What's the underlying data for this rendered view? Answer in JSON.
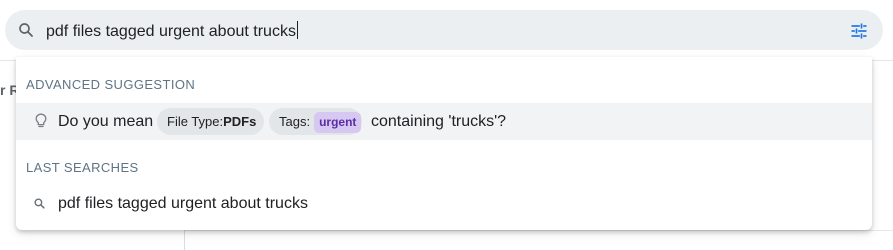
{
  "search": {
    "query": "pdf files tagged urgent about trucks",
    "icon": "search-icon",
    "filter_icon": "tune-icon"
  },
  "background": {
    "nav_label_fragment": "r R"
  },
  "dropdown": {
    "advanced_header": "ADVANCED SUGGESTION",
    "suggestion": {
      "prefix": "Do you mean",
      "file_type_label": "File Type:",
      "file_type_value": "PDFs",
      "tags_label": "Tags:",
      "tag_value": "urgent",
      "suffix": "containing 'trucks'?",
      "icon": "lightbulb-icon"
    },
    "last_header": "LAST SEARCHES",
    "history": [
      {
        "text": "pdf files tagged urgent about trucks",
        "icon": "search-icon"
      }
    ]
  },
  "colors": {
    "search_bar_bg": "#eceff1",
    "accent": "#1a73e8",
    "header_text": "#5f7485",
    "tag_pill_bg": "#d7c8f2",
    "tag_pill_text": "#5a2ea6",
    "highlight_row_bg": "#f1f3f4"
  }
}
